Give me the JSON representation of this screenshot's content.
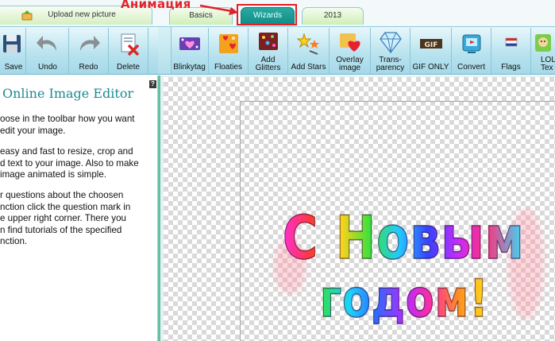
{
  "annotation": {
    "label": "Анимация"
  },
  "tabs": {
    "upload": "Upload new picture",
    "basics": "Basics",
    "wizards": "Wizards",
    "year": "2013"
  },
  "toolbar": {
    "buttons": [
      {
        "label": "Save",
        "icon": "floppy-disk-icon"
      },
      {
        "label": "Undo",
        "icon": "undo-arrow-icon"
      },
      {
        "label": "Redo",
        "icon": "redo-arrow-icon"
      },
      {
        "label": "Delete",
        "icon": "delete-icon"
      },
      {
        "label": "Blinkytag",
        "icon": "blinkytag-icon"
      },
      {
        "label": "Floaties",
        "icon": "floaties-icon"
      },
      {
        "label": "Add Glitters",
        "icon": "glitter-icon"
      },
      {
        "label": "Add Stars",
        "icon": "stars-icon"
      },
      {
        "label": "Overlay image",
        "icon": "overlay-heart-icon"
      },
      {
        "label": "Trans-parency",
        "icon": "diamond-icon"
      },
      {
        "label": "GIF ONLY",
        "icon": "gif-icon"
      },
      {
        "label": "Convert",
        "icon": "convert-icon"
      },
      {
        "label": "Flags",
        "icon": "flag-icon"
      },
      {
        "label": "LOLC Tex",
        "icon": "lolcat-icon"
      }
    ]
  },
  "panel": {
    "title": "Online Image Editor",
    "help": "?",
    "p1": [
      "oose in the toolbar how you want",
      "edit your image."
    ],
    "p2": [
      "easy and fast to resize, crop and",
      "d text to your image. Also to make",
      "image animated is simple."
    ],
    "p3": [
      "r questions about the choosen",
      "nction click the question mark in",
      "e upper right corner. There you",
      "n find tutorials of the specified",
      "nction."
    ]
  },
  "canvas": {
    "line1": "С Новым",
    "line2": "годом!"
  },
  "colors": {
    "accent_tab": "#0f8d86",
    "highlight": "#e21f25",
    "title": "#1c8a93"
  }
}
